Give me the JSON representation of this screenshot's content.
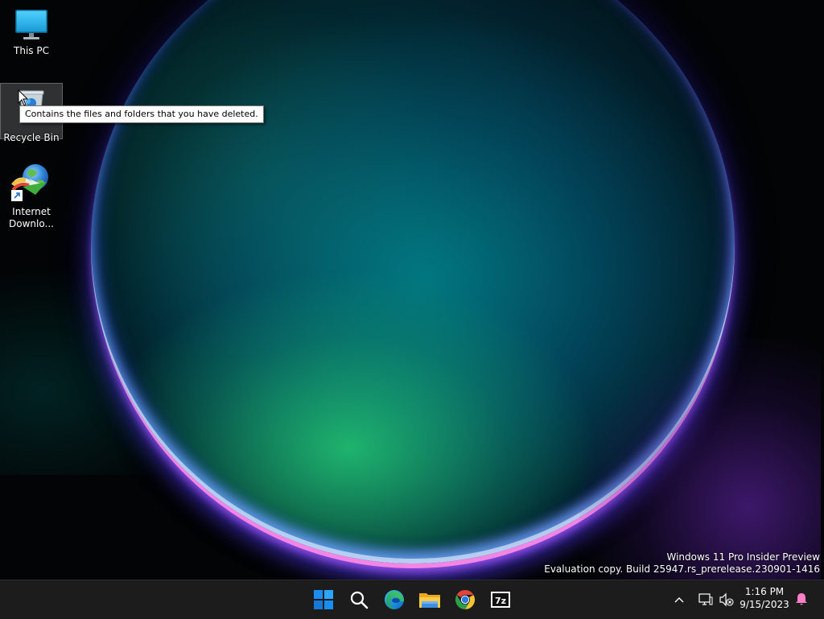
{
  "desktop": {
    "icons": [
      {
        "label": "This PC",
        "icon": "this-pc-icon"
      },
      {
        "label": "Recycle Bin",
        "icon": "recycle-bin-icon"
      },
      {
        "label": "Internet Downlo...",
        "icon": "internet-download-manager-icon"
      }
    ],
    "tooltip": "Contains the files and folders that you have deleted.",
    "watermark": {
      "line1": "Windows 11 Pro Insider Preview",
      "line2": "Evaluation copy. Build 25947.rs_prerelease.230901-1416"
    }
  },
  "taskbar": {
    "pinned": [
      {
        "name": "Start",
        "icon": "windows-start-icon"
      },
      {
        "name": "Search",
        "icon": "search-icon"
      },
      {
        "name": "Microsoft Edge",
        "icon": "edge-icon"
      },
      {
        "name": "File Explorer",
        "icon": "file-explorer-icon"
      },
      {
        "name": "Google Chrome",
        "icon": "chrome-icon"
      },
      {
        "name": "7-Zip",
        "icon": "7zip-icon"
      }
    ],
    "tray": {
      "overflow_icon": "chevron-up-icon",
      "network_icon": "network-icon",
      "volume_icon": "volume-muted-icon",
      "time": "1:16 PM",
      "date": "9/15/2023",
      "notification_icon": "notification-bell-icon"
    },
    "start_color": "#1a8ef0",
    "notification_color": "#ff80c8"
  }
}
